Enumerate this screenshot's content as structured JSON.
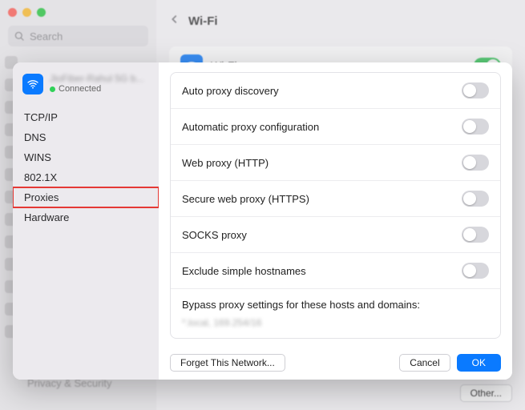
{
  "bg": {
    "search_placeholder": "Search",
    "title": "Wi-Fi",
    "wifi_label": "Wi-Fi",
    "other_btn": "Other...",
    "privacy_item": "Privacy & Security"
  },
  "modal": {
    "network": {
      "name_obscured": "JioFiber-Rahul 5G b...",
      "status": "Connected"
    },
    "tabs": [
      {
        "label": "TCP/IP"
      },
      {
        "label": "DNS"
      },
      {
        "label": "WINS"
      },
      {
        "label": "802.1X"
      },
      {
        "label": "Proxies"
      },
      {
        "label": "Hardware"
      }
    ],
    "proxy_rows": [
      {
        "label": "Auto proxy discovery",
        "on": false
      },
      {
        "label": "Automatic proxy configuration",
        "on": false
      },
      {
        "label": "Web proxy (HTTP)",
        "on": false
      },
      {
        "label": "Secure web proxy (HTTPS)",
        "on": false
      },
      {
        "label": "SOCKS proxy",
        "on": false
      },
      {
        "label": "Exclude simple hostnames",
        "on": false
      }
    ],
    "bypass": {
      "label": "Bypass proxy settings for these hosts and domains:",
      "value_obscured": "*.local, 169.254/16"
    },
    "footer": {
      "forget": "Forget This Network...",
      "cancel": "Cancel",
      "ok": "OK"
    }
  }
}
